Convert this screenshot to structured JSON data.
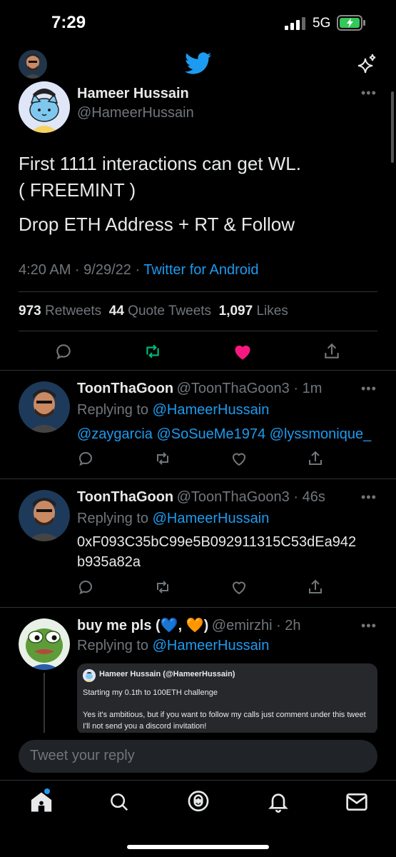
{
  "status_bar": {
    "time": "7:29",
    "network": "5G"
  },
  "tweet": {
    "author_name": "Hameer Hussain",
    "author_handle": "@HameerHussain",
    "text_line1": "First 1111 interactions can get WL.",
    "text_line2": "( FREEMINT )",
    "text_line3": "Drop ETH Address + RT & Follow",
    "timestamp": "4:20 AM · 9/29/22 · ",
    "source": "Twitter for Android",
    "retweets_count": "973",
    "retweets_label": "Retweets",
    "quotes_count": "44",
    "quotes_label": "Quote Tweets",
    "likes_count": "1,097",
    "likes_label": "Likes"
  },
  "replies": [
    {
      "name": "ToonThaGoon",
      "handle_time": "@ToonThaGoon3 · 1m",
      "replying_prefix": "Replying to ",
      "replying_handle": "@HameerHussain",
      "text": "@zaygarcia @SoSueMe1974 @lyssmonique_"
    },
    {
      "name": "ToonThaGoon",
      "handle_time": "@ToonThaGoon3 · 46s",
      "replying_prefix": "Replying to ",
      "replying_handle": "@HameerHussain",
      "text_line1": "0xF093C35bC99e5B092911315C53dEa942",
      "text_line2": "b935a82a"
    },
    {
      "name_prefix": "buy me pls (",
      "name_emoji1": "💙",
      "name_mid": ",",
      "name_emoji2": "🧡",
      "name_suffix": ")",
      "handle_time": "@emirzhi · 2h",
      "replying_prefix": "Replying to ",
      "replying_handle": "@HameerHussain",
      "embed_author": "Hameer Hussain (@HameerHussain)",
      "embed_line1": "Starting my 0.1th to 100ETH challenge",
      "embed_line2": "Yes it's ambitious, but if you want to follow my calls just comment under this tweet",
      "embed_line3": "I'll not send you a discord invitation!"
    }
  ],
  "reply_input": {
    "placeholder": "Tweet your reply"
  },
  "colors": {
    "accent": "#1d9bf0",
    "like": "#f91880",
    "retweet": "#00ba7c",
    "background": "#000000"
  }
}
